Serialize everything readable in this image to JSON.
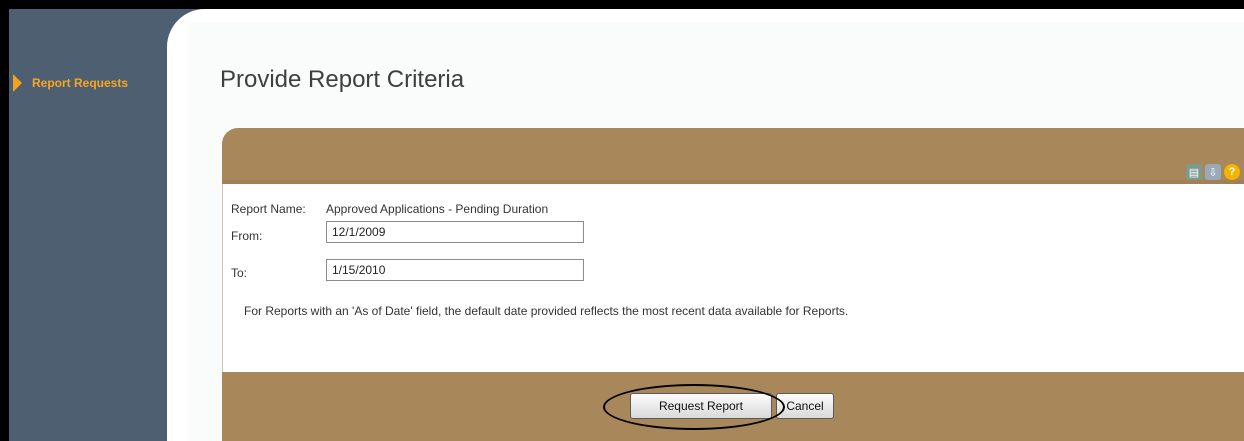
{
  "sidebar": {
    "items": [
      {
        "label": "Report Requests",
        "icon": "arrow-right-icon",
        "active": true
      }
    ]
  },
  "page": {
    "title": "Provide Report Criteria"
  },
  "header_icons": [
    "print-icon",
    "export-icon",
    "help-icon"
  ],
  "form": {
    "report_name_label": "Report Name:",
    "report_name_value": "Approved Applications - Pending Duration",
    "from_label": "From:",
    "from_value": "12/1/2009",
    "to_label": "To:",
    "to_value": "1/15/2010",
    "note": "For Reports with an 'As of Date' field, the default date provided reflects the most recent data available for Reports."
  },
  "buttons": {
    "request_label": "Request Report",
    "cancel_label": "Cancel"
  },
  "colors": {
    "sidebar": "#4d5f71",
    "accent_orange": "#f6a623",
    "panel_brown": "#a8875a"
  }
}
